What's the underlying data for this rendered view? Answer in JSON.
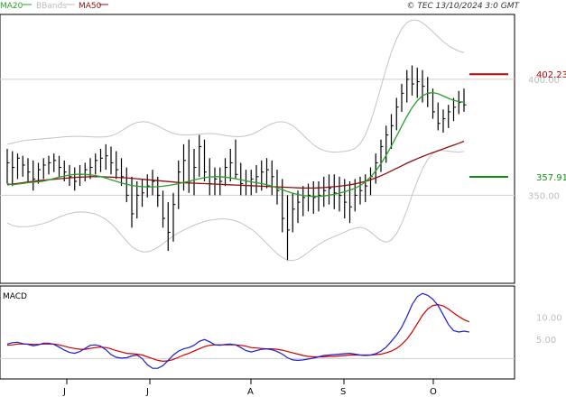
{
  "header": {
    "legend": [
      {
        "label": "MA20",
        "color": "#2aa02a"
      },
      {
        "label": "BBands",
        "color": "#bdbdbd"
      },
      {
        "label": "MA50",
        "color": "#8b1010"
      }
    ],
    "source": "© TEC 13/10/2024 3:0 GMT"
  },
  "markers": [
    {
      "label": "402.23",
      "value": 402.23,
      "color": "#c00000"
    },
    {
      "label": "357.91",
      "value": 357.91,
      "color": "#109010"
    }
  ],
  "price_axis": {
    "ticks": [
      {
        "value": 400,
        "label": "400.00"
      },
      {
        "value": 350,
        "label": "350.00"
      }
    ],
    "ylim": [
      312,
      428
    ]
  },
  "macd_panel": {
    "title": "MACD",
    "ticks": [
      {
        "value": 10,
        "label": "10.00"
      },
      {
        "value": 5,
        "label": "5.00"
      }
    ],
    "ylim": [
      -4,
      17
    ]
  },
  "x_axis": {
    "labels": [
      "J",
      "J",
      "A",
      "S",
      "O"
    ]
  },
  "chart_data": {
    "type": "line",
    "x_months": [
      "J",
      "J",
      "A",
      "S",
      "O"
    ],
    "price": {
      "title": "",
      "ylabel": "",
      "ylim": [
        312,
        428
      ],
      "yticks": [
        350,
        400
      ],
      "bars": [
        [
          370,
          355,
          364
        ],
        [
          369,
          354,
          362
        ],
        [
          368,
          357,
          366
        ],
        [
          367,
          358,
          363
        ],
        [
          366,
          356,
          360
        ],
        [
          365,
          352,
          357
        ],
        [
          364,
          355,
          361
        ],
        [
          366,
          357,
          363
        ],
        [
          367,
          359,
          364
        ],
        [
          368,
          360,
          365
        ],
        [
          367,
          358,
          362
        ],
        [
          365,
          356,
          360
        ],
        [
          363,
          354,
          358
        ],
        [
          362,
          352,
          356
        ],
        [
          363,
          354,
          359
        ],
        [
          364,
          356,
          361
        ],
        [
          366,
          357,
          362
        ],
        [
          368,
          359,
          365
        ],
        [
          370,
          360,
          366
        ],
        [
          372,
          361,
          367
        ],
        [
          371,
          359,
          364
        ],
        [
          369,
          357,
          361
        ],
        [
          366,
          354,
          358
        ],
        [
          362,
          347,
          350
        ],
        [
          358,
          336,
          342
        ],
        [
          356,
          340,
          350
        ],
        [
          357,
          345,
          351
        ],
        [
          359,
          349,
          354
        ],
        [
          361,
          350,
          356
        ],
        [
          358,
          345,
          350
        ],
        [
          352,
          336,
          340
        ],
        [
          347,
          326,
          334
        ],
        [
          351,
          330,
          346
        ],
        [
          365,
          344,
          360
        ],
        [
          372,
          352,
          365
        ],
        [
          374,
          351,
          356
        ],
        [
          370,
          350,
          362
        ],
        [
          376,
          358,
          371
        ],
        [
          374,
          356,
          360
        ],
        [
          366,
          350,
          355
        ],
        [
          362,
          350,
          357
        ],
        [
          362,
          350,
          356
        ],
        [
          366,
          354,
          362
        ],
        [
          370,
          356,
          364
        ],
        [
          374,
          357,
          359
        ],
        [
          364,
          350,
          355
        ],
        [
          361,
          350,
          356
        ],
        [
          361,
          350,
          357
        ],
        [
          363,
          351,
          358
        ],
        [
          365,
          352,
          360
        ],
        [
          366,
          353,
          361
        ],
        [
          365,
          350,
          358
        ],
        [
          361,
          346,
          352
        ],
        [
          357,
          334,
          340
        ],
        [
          350,
          322,
          335
        ],
        [
          351,
          334,
          344
        ],
        [
          352,
          338,
          347
        ],
        [
          354,
          341,
          349
        ],
        [
          355,
          343,
          350
        ],
        [
          356,
          342,
          349
        ],
        [
          356,
          343,
          350
        ],
        [
          358,
          345,
          352
        ],
        [
          359,
          346,
          353
        ],
        [
          359,
          344,
          351
        ],
        [
          358,
          343,
          350
        ],
        [
          357,
          340,
          347
        ],
        [
          356,
          338,
          345
        ],
        [
          357,
          343,
          350
        ],
        [
          358,
          346,
          352
        ],
        [
          359,
          347,
          354
        ],
        [
          362,
          350,
          358
        ],
        [
          368,
          355,
          364
        ],
        [
          374,
          360,
          371
        ],
        [
          380,
          364,
          376
        ],
        [
          385,
          370,
          380
        ],
        [
          392,
          378,
          388
        ],
        [
          398,
          386,
          394
        ],
        [
          404,
          390,
          400
        ],
        [
          406,
          393,
          398
        ],
        [
          405,
          392,
          399
        ],
        [
          404,
          390,
          397
        ],
        [
          401,
          388,
          394
        ],
        [
          396,
          383,
          386
        ],
        [
          390,
          378,
          381
        ],
        [
          387,
          377,
          383
        ],
        [
          389,
          379,
          386
        ],
        [
          392,
          382,
          388
        ],
        [
          395,
          385,
          390
        ],
        [
          396,
          386,
          389
        ]
      ],
      "ma20": [
        355,
        354.5,
        354.8,
        355.1,
        355.4,
        355.6,
        355.8,
        356.1,
        356.6,
        357.2,
        357.8,
        358.3,
        358.7,
        359,
        359.1,
        359,
        358.8,
        358.5,
        358,
        357.4,
        356.7,
        356,
        355.3,
        354.7,
        354.2,
        353.9,
        353.7,
        353.6,
        353.6,
        353.7,
        353.9,
        354.2,
        354.6,
        355,
        355.5,
        356,
        356.6,
        357.1,
        357.6,
        357.9,
        358,
        358,
        357.8,
        357.5,
        357.1,
        356.7,
        356.2,
        355.8,
        355.4,
        355,
        354.5,
        353.9,
        353.2,
        352.4,
        351.6,
        350.9,
        350.3,
        349.9,
        349.6,
        349.5,
        349.5,
        349.7,
        350,
        350.4,
        350.9,
        351.5,
        352.2,
        353,
        354.2,
        355.8,
        357.9,
        360.5,
        363.6,
        367.2,
        371.2,
        375.5,
        379.8,
        384,
        387.8,
        390.8,
        392.9,
        394,
        394.3,
        393.8,
        392.8,
        391.8,
        391,
        390.4,
        390.2
      ],
      "ma50": [
        354.5,
        354.8,
        355.1,
        355.4,
        355.7,
        356,
        356.3,
        356.5,
        356.7,
        356.9,
        357.1,
        357.3,
        357.5,
        357.7,
        357.8,
        357.9,
        358,
        358,
        358,
        357.9,
        357.8,
        357.7,
        357.6,
        357.5,
        357.3,
        357.1,
        356.9,
        356.7,
        356.5,
        356.3,
        356.1,
        355.9,
        355.7,
        355.5,
        355.4,
        355.3,
        355.2,
        355.1,
        355,
        354.9,
        354.8,
        354.7,
        354.6,
        354.5,
        354.4,
        354.3,
        354.2,
        354.1,
        354,
        353.9,
        353.8,
        353.7,
        353.6,
        353.5,
        353.4,
        353.3,
        353.2,
        353.1,
        353.1,
        353.1,
        353.2,
        353.3,
        353.5,
        353.7,
        353.9,
        354.2,
        354.5,
        354.9,
        355.4,
        356,
        356.7,
        357.5,
        358.4,
        359.4,
        360.5,
        361.6,
        362.7,
        363.8,
        364.8,
        365.8,
        366.7,
        367.6,
        368.4,
        369.2,
        370,
        370.8,
        371.6,
        372.4,
        373.3
      ],
      "bb_upper": [
        372,
        372.5,
        373,
        373.5,
        373.8,
        374,
        374.2,
        374.4,
        374.6,
        374.8,
        375,
        375.2,
        375.3,
        375.4,
        375.4,
        375.3,
        375.2,
        375.1,
        375.1,
        375.2,
        375.6,
        376.5,
        377.8,
        379.2,
        380.5,
        381.4,
        381.8,
        381.6,
        380.9,
        379.9,
        378.7,
        377.6,
        376.7,
        376.2,
        376,
        376,
        376.1,
        376.3,
        376.5,
        376.6,
        376.5,
        376.2,
        375.8,
        375.5,
        375.3,
        375.3,
        375.6,
        376.2,
        377.2,
        378.5,
        379.8,
        380.9,
        381.6,
        381.7,
        381.2,
        380,
        378.2,
        376,
        373.8,
        371.8,
        370.3,
        369.3,
        368.8,
        368.6,
        368.7,
        368.9,
        369.3,
        370.2,
        372.2,
        376,
        381.7,
        388.8,
        396.7,
        404.7,
        411.7,
        417.5,
        421.8,
        424.5,
        425.6,
        425.5,
        424.4,
        422.6,
        420.5,
        418.3,
        416.3,
        414.6,
        413.2,
        412.2,
        411.5
      ],
      "bb_lower": [
        338,
        337,
        336.5,
        336.4,
        336.5,
        336.8,
        337.3,
        337.8,
        338.6,
        339.5,
        340.6,
        341.4,
        342.1,
        342.6,
        342.8,
        342.7,
        342.4,
        341.9,
        340.9,
        339.6,
        337.8,
        335.5,
        332.8,
        330.2,
        327.9,
        326.4,
        325.6,
        325.6,
        326.3,
        327.5,
        329.1,
        330.8,
        332.5,
        333.8,
        335,
        336,
        337.1,
        337.9,
        338.7,
        339.2,
        339.5,
        339.8,
        339.8,
        339.5,
        338.9,
        338.1,
        336.8,
        335.4,
        333.6,
        331.5,
        329.2,
        326.9,
        324.8,
        323.1,
        322,
        321.8,
        322.4,
        323.8,
        325.4,
        327.2,
        328.7,
        330.1,
        331.2,
        332.2,
        333.1,
        334.1,
        335.1,
        335.8,
        336.2,
        335.6,
        334.1,
        332.2,
        330.5,
        329.7,
        330.7,
        333.5,
        337.8,
        343.5,
        350,
        356.1,
        361.4,
        365.4,
        368.1,
        369.3,
        369.3,
        369,
        368.8,
        368.6,
        368.9
      ]
    },
    "macd": {
      "title": "MACD",
      "ylim": [
        -4,
        17
      ],
      "yticks": [
        5,
        10
      ],
      "macd_line": [
        3.9,
        4.2,
        4.3,
        4,
        3.8,
        3.5,
        3.7,
        4.1,
        4.1,
        3.8,
        3.2,
        2.5,
        2,
        1.8,
        2.2,
        2.9,
        3.6,
        3.7,
        3.4,
        2.6,
        1.5,
        0.9,
        0.7,
        0.8,
        1.2,
        1.4,
        0.6,
        -0.8,
        -1.6,
        -1.6,
        -1,
        0.2,
        1.4,
        2.3,
        2.8,
        3.1,
        3.6,
        4.5,
        4.9,
        4.4,
        3.7,
        3.6,
        3.8,
        3.9,
        3.7,
        3.1,
        2.4,
        2.1,
        2.4,
        2.7,
        2.8,
        2.6,
        2.2,
        1.6,
        0.8,
        0.3,
        0.2,
        0.3,
        0.5,
        0.7,
        1,
        1.3,
        1.4,
        1.5,
        1.6,
        1.7,
        1.8,
        1.6,
        1.4,
        1.3,
        1.4,
        1.7,
        2.3,
        3.2,
        4.5,
        5.9,
        7.7,
        10.1,
        12.8,
        14.6,
        15.3,
        14.9,
        14,
        12.6,
        10.5,
        8.3,
        6.9,
        6.6,
        6.8,
        6.6
      ],
      "signal_line": [
        3.6,
        3.7,
        3.9,
        3.9,
        3.9,
        3.8,
        3.8,
        3.9,
        3.9,
        3.9,
        3.7,
        3.4,
        3.1,
        2.9,
        2.7,
        2.7,
        2.9,
        3.1,
        3.2,
        3.1,
        2.8,
        2.4,
        2.1,
        1.8,
        1.7,
        1.6,
        1.4,
        1,
        0.6,
        0.2,
        0,
        0.1,
        0.4,
        0.9,
        1.4,
        1.8,
        2.3,
        2.8,
        3.3,
        3.6,
        3.7,
        3.7,
        3.7,
        3.7,
        3.7,
        3.6,
        3.4,
        3.1,
        3,
        2.9,
        2.8,
        2.8,
        2.7,
        2.5,
        2.2,
        1.9,
        1.6,
        1.3,
        1.1,
        1,
        1,
        1,
        1.1,
        1.1,
        1.2,
        1.3,
        1.4,
        1.4,
        1.4,
        1.4,
        1.4,
        1.5,
        1.6,
        1.9,
        2.3,
        2.9,
        3.8,
        5,
        6.6,
        8.5,
        10.4,
        11.8,
        12.6,
        12.8,
        12.5,
        11.8,
        10.9,
        10.1,
        9.4,
        8.9
      ]
    }
  }
}
